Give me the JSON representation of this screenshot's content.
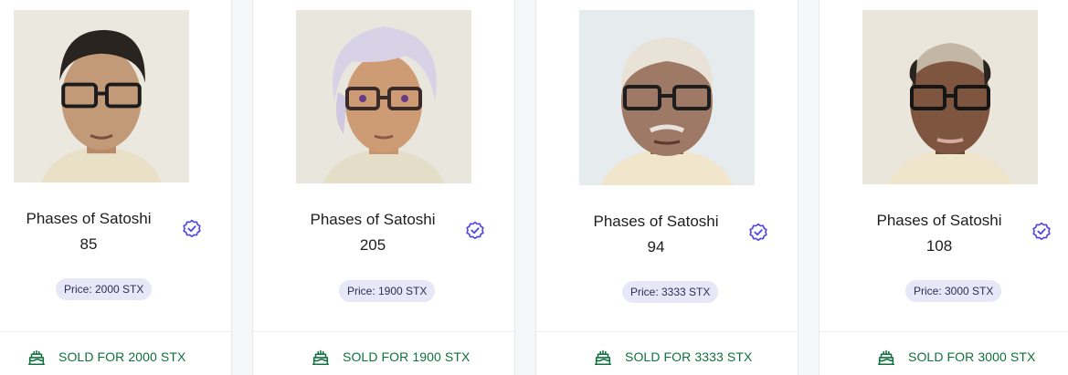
{
  "cards": [
    {
      "title": "Phases of Satoshi",
      "number": "85",
      "price": "Price: 2000 STX",
      "sold": "SOLD FOR 2000 STX",
      "portrait": "young-man-dark-hair-glasses"
    },
    {
      "title": "Phases of Satoshi",
      "number": "205",
      "price": "Price: 1900 STX",
      "sold": "SOLD FOR 1900 STX",
      "portrait": "person-white-hair-glasses"
    },
    {
      "title": "Phases of Satoshi",
      "number": "94",
      "price": "Price: 3333 STX",
      "sold": "SOLD FOR 3333 STX",
      "portrait": "elderly-man-glasses"
    },
    {
      "title": "Phases of Satoshi",
      "number": "108",
      "price": "Price: 3000 STX",
      "sold": "SOLD FOR 3000 STX",
      "portrait": "balding-man-glasses"
    }
  ],
  "icons": {
    "verified": "verified-badge-icon",
    "sold": "cake-icon"
  },
  "colors": {
    "verified": "#4f46e5",
    "sold_text": "#11703f",
    "price_pill_bg": "#e6e7f7",
    "price_pill_text": "#2f2f55"
  }
}
